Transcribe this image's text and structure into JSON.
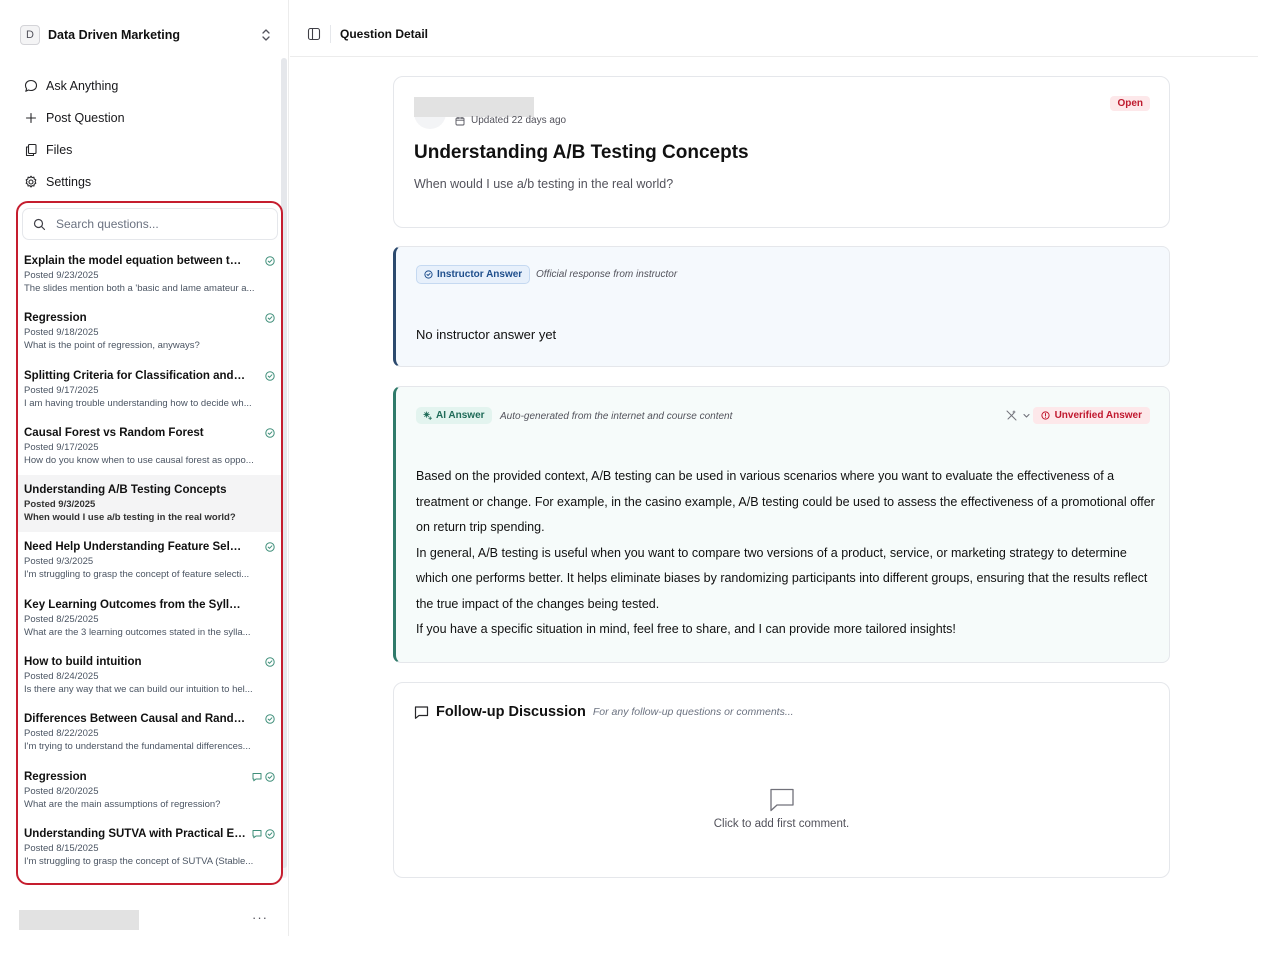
{
  "workspace": {
    "initial": "D",
    "name": "Data Driven Marketing"
  },
  "nav": [
    {
      "label": "Ask Anything",
      "icon": "chat-bubble-icon"
    },
    {
      "label": "Post Question",
      "icon": "plus-icon"
    },
    {
      "label": "Files",
      "icon": "files-icon"
    },
    {
      "label": "Settings",
      "icon": "gear-icon"
    }
  ],
  "search": {
    "placeholder": "Search questions..."
  },
  "questions": [
    {
      "title": "Explain the model equation between the slides",
      "date": "Posted 9/23/2025",
      "snippet": "The slides mention both a 'basic and lame amateur a...",
      "answered": true
    },
    {
      "title": "Regression",
      "date": "Posted 9/18/2025",
      "snippet": "What is the point of regression, anyways?",
      "answered": true
    },
    {
      "title": "Splitting Criteria for Classification and Regression",
      "date": "Posted 9/17/2025",
      "snippet": "I am having trouble understanding how to decide wh...",
      "answered": true
    },
    {
      "title": "Causal Forest vs Random Forest",
      "date": "Posted 9/17/2025",
      "snippet": "How do you know when to use causal forest as oppo...",
      "answered": true
    },
    {
      "title": "Understanding A/B Testing Concepts",
      "date": "Posted 9/3/2025",
      "snippet": "When would I use a/b testing in the real world?",
      "answered": false,
      "active": true
    },
    {
      "title": "Need Help Understanding Feature Selection",
      "date": "Posted 9/3/2025",
      "snippet": "I'm struggling to grasp the concept of feature selecti...",
      "answered": true
    },
    {
      "title": "Key Learning Outcomes from the Syllabus",
      "date": "Posted 8/25/2025",
      "snippet": "What are the 3 learning outcomes stated in the sylla...",
      "answered": false
    },
    {
      "title": "How to build intuition",
      "date": "Posted 8/24/2025",
      "snippet": "Is there any way that we can build our intuition to hel...",
      "answered": true
    },
    {
      "title": "Differences Between Causal and Random Forest",
      "date": "Posted 8/22/2025",
      "snippet": "I'm trying to understand the fundamental differences...",
      "answered": true
    },
    {
      "title": "Regression",
      "date": "Posted 8/20/2025",
      "snippet": "What are the main assumptions of regression?",
      "answered": true,
      "comment": true
    },
    {
      "title": "Understanding SUTVA with Practical Examples",
      "date": "Posted 8/15/2025",
      "snippet": "I'm struggling to grasp the concept of SUTVA (Stable...",
      "answered": true,
      "comment": true
    }
  ],
  "header": {
    "title": "Question Detail"
  },
  "question": {
    "updated": "Updated 22 days ago",
    "status": "Open",
    "title": "Understanding A/B Testing Concepts",
    "body": "When would I use a/b testing in the real world?"
  },
  "instructor": {
    "label": "Instructor Answer",
    "note": "Official response from instructor",
    "body": "No instructor answer yet"
  },
  "ai": {
    "label": "AI Answer",
    "note": "Auto-generated from the internet and course content",
    "badge": "Unverified Answer",
    "paragraphs": [
      "Based on the provided context, A/B testing can be used in various scenarios where you want to evaluate the effectiveness of a treatment or change. For example, in the casino example, A/B testing could be used to assess the effectiveness of a promotional offer on return trip spending.",
      "In general, A/B testing is useful when you want to compare two versions of a product, service, or marketing strategy to determine which one performs better. It helps eliminate biases by randomizing participants into different groups, ensuring that the results reflect the true impact of the changes being tested.",
      "If you have a specific situation in mind, feel free to share, and I can provide more tailored insights!"
    ]
  },
  "discussion": {
    "title": "Follow-up Discussion",
    "note": "For any follow-up questions or comments...",
    "empty": "Click to add first comment."
  },
  "sidebar_footer": {
    "more": "···"
  },
  "colors": {
    "accent_red": "#c51d2e",
    "instructor": "#2c4a6e",
    "ai": "#2f7a6a"
  }
}
